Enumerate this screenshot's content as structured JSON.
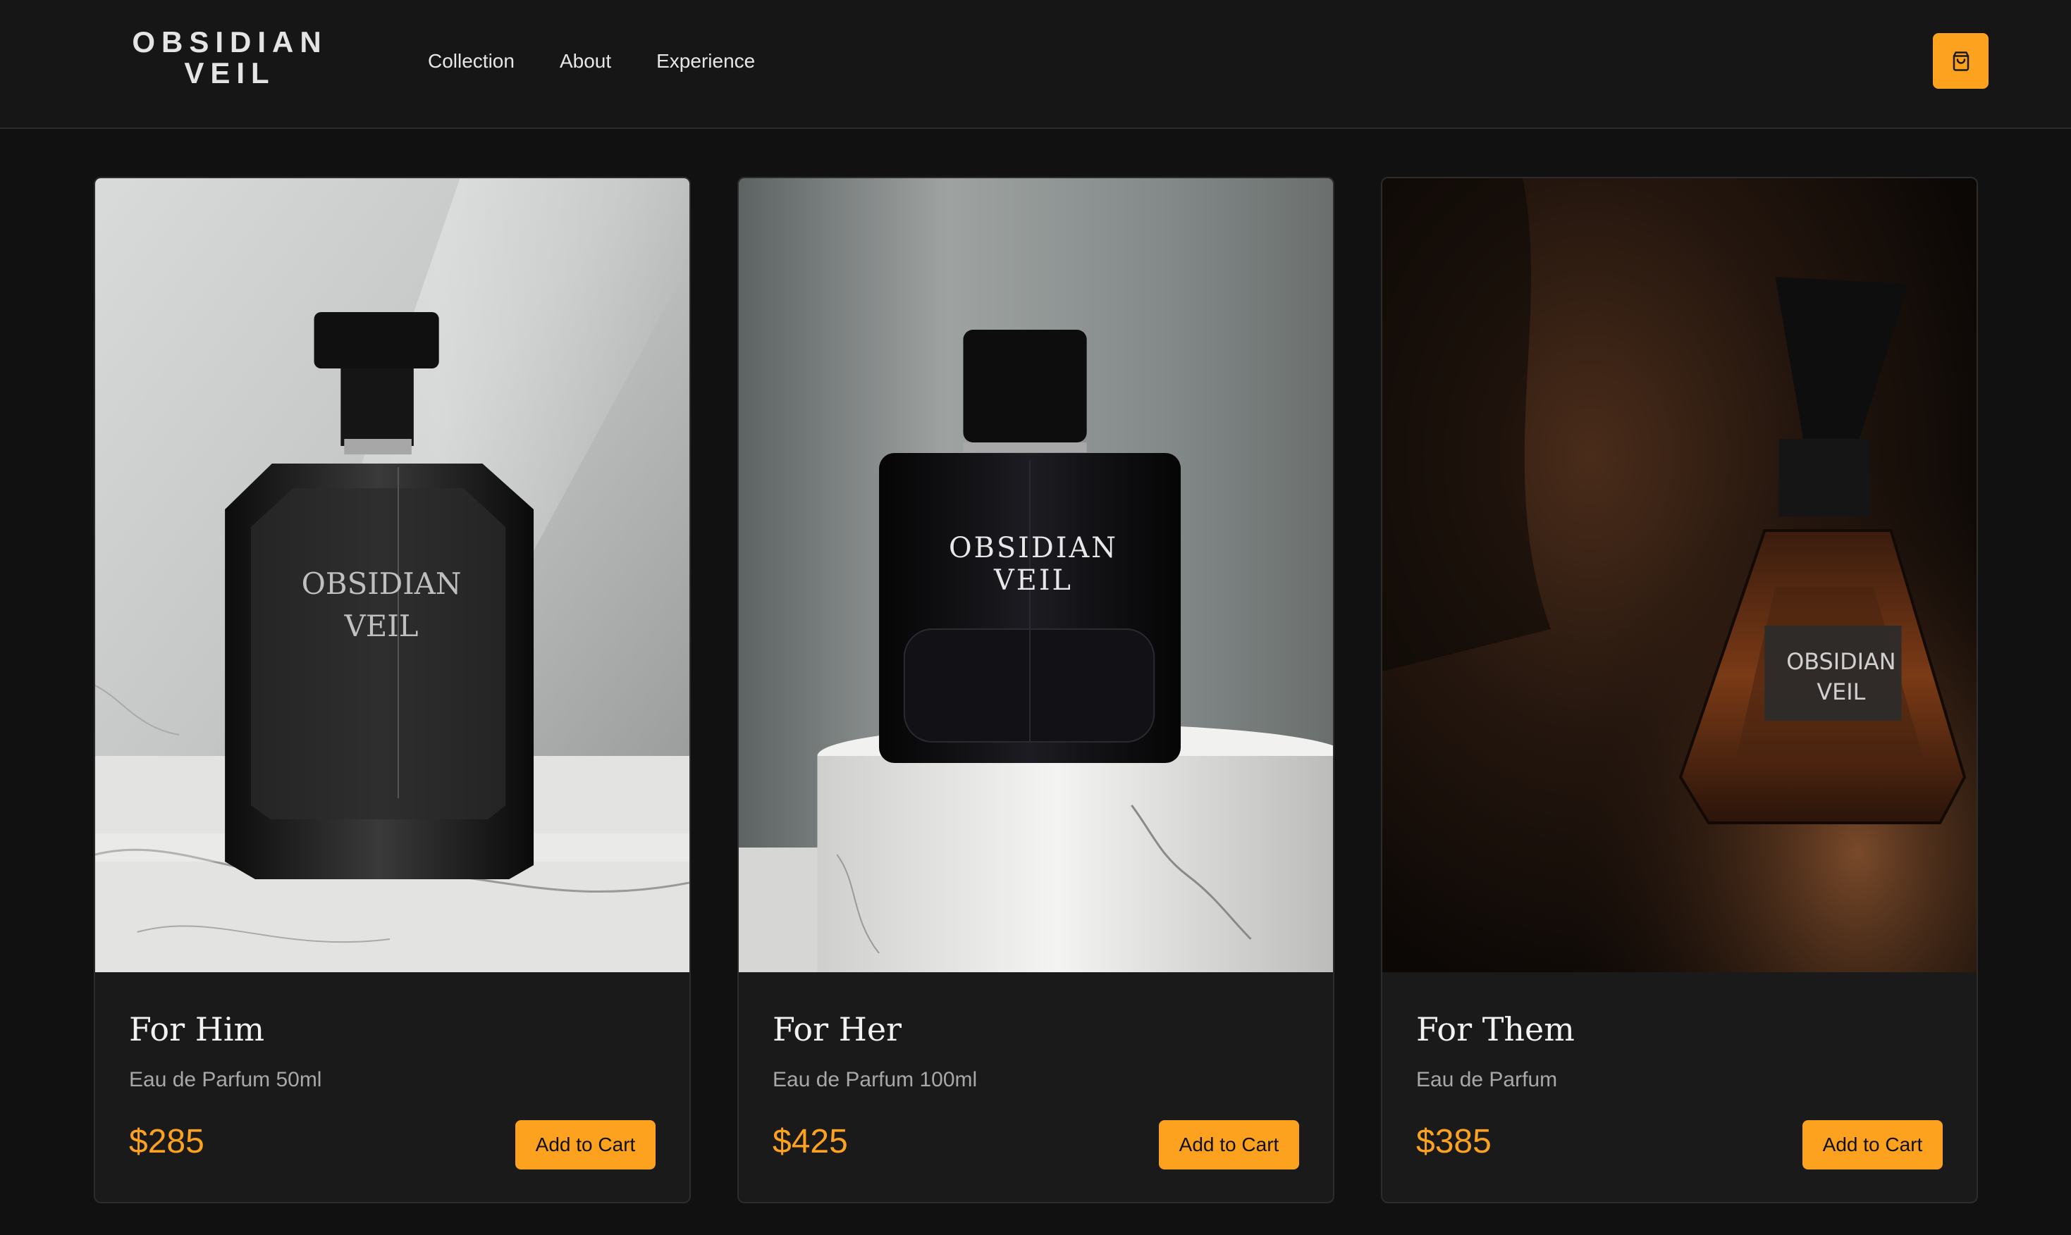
{
  "brand": {
    "line1": "OBSIDIAN",
    "line2": "VEIL"
  },
  "nav": [
    {
      "label": "Collection"
    },
    {
      "label": "About"
    },
    {
      "label": "Experience"
    }
  ],
  "cart": {
    "icon": "shopping-bag-icon"
  },
  "colors": {
    "accent": "#fda21f",
    "background": "#111111",
    "card": "#1a1a1a"
  },
  "products": [
    {
      "title": "For Him",
      "subtitle": "Eau de Parfum 50ml",
      "price": "$285",
      "button": "Add to Cart",
      "bottle_label_1": "OBSIDIAN",
      "bottle_label_2": "VEIL"
    },
    {
      "title": "For Her",
      "subtitle": "Eau de Parfum 100ml",
      "price": "$425",
      "button": "Add to Cart",
      "bottle_label_1": "OBSIDIAN",
      "bottle_label_2": "VEIL"
    },
    {
      "title": "For Them",
      "subtitle": "Eau de Parfum",
      "price": "$385",
      "button": "Add to Cart",
      "bottle_label_1": "OBSIDIAN",
      "bottle_label_2": "VEIL"
    }
  ]
}
